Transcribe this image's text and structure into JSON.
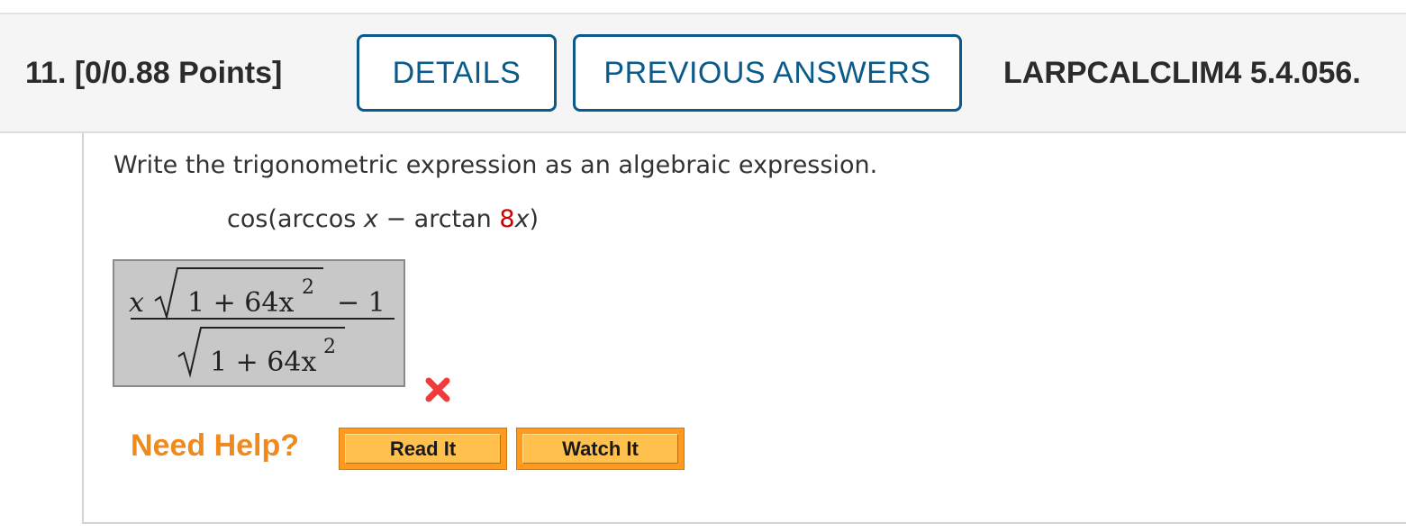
{
  "header": {
    "question_label": "11.  [0/0.88 Points]",
    "details_label": "DETAILS",
    "previous_answers_label": "PREVIOUS ANSWERS",
    "problem_code": "LARPCALCLIM4 5.4.056."
  },
  "question": {
    "prompt": "Write the trigonometric expression as an algebraic expression.",
    "expression": {
      "part1": "cos(arccos ",
      "var1": "x",
      "part2": " − arctan ",
      "coefficient": "8",
      "var2": "x",
      "part3": ")"
    }
  },
  "answer": {
    "numerator": {
      "x": "x",
      "radicand": "1 + 64x",
      "exponent": "2",
      "tail": "− 1"
    },
    "denominator": {
      "radicand": "1 + 64x",
      "exponent": "2"
    },
    "status_icon": "wrong-x-icon"
  },
  "help": {
    "label": "Need Help?",
    "read_label": "Read It",
    "watch_label": "Watch It"
  },
  "colors": {
    "accent_blue": "#0a5a8a",
    "help_orange": "#f08a1c",
    "error_red": "#ef3b3b",
    "coefficient_red": "#cc0000"
  }
}
